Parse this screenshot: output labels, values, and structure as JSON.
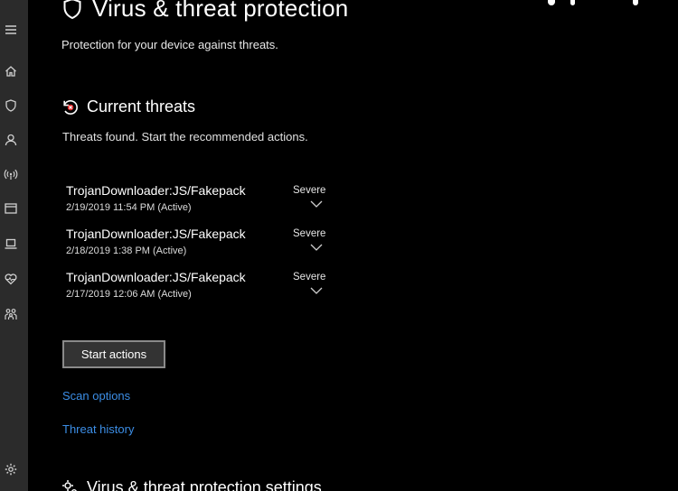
{
  "page": {
    "title": "Virus & threat protection",
    "subtitle": "Protection for your device against threats."
  },
  "current_threats": {
    "heading": "Current threats",
    "description": "Threats found. Start the recommended actions.",
    "items": [
      {
        "name": "TrojanDownloader:JS/Fakepack",
        "date": "2/19/2019 11:54 PM (Active)",
        "severity": "Severe"
      },
      {
        "name": "TrojanDownloader:JS/Fakepack",
        "date": "2/18/2019 1:38 PM (Active)",
        "severity": "Severe"
      },
      {
        "name": "TrojanDownloader:JS/Fakepack",
        "date": "2/17/2019 12:06 AM (Active)",
        "severity": "Severe"
      }
    ],
    "action_button": "Start actions",
    "links": [
      "Scan options",
      "Threat history"
    ]
  },
  "next_section": {
    "heading": "Virus & threat protection settings"
  },
  "colors": {
    "background": "#000000",
    "rail": "#2b2b2b",
    "link": "#3c8ee6",
    "text": "#ffffff"
  },
  "rail_icons": [
    "hamburger-icon",
    "home-icon",
    "shield-icon",
    "person-icon",
    "wifi-icon",
    "browser-icon",
    "laptop-icon",
    "heart-icon",
    "family-icon",
    "gear-icon"
  ]
}
